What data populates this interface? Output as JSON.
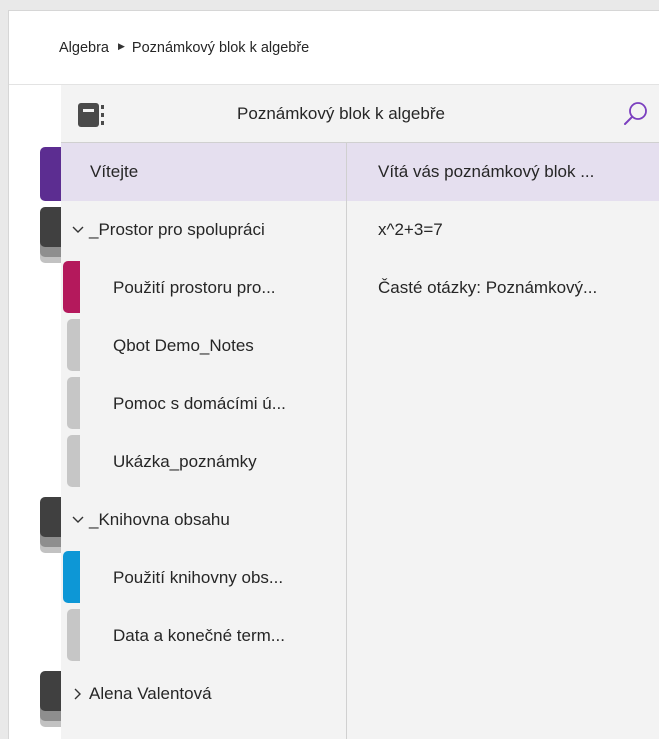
{
  "breadcrumb": {
    "notebook_group": "Algebra",
    "separator": "▶",
    "notebook": "Poznámkový blok k algebře"
  },
  "notebook_header": {
    "title": "Poznámkový blok k algebře",
    "icon": "notebook-icon",
    "search_icon": "search-icon"
  },
  "accent_color": "#5c2d91",
  "selection_color": "#e5dfef",
  "sections": {
    "welcome": "Vítejte",
    "collab_group": {
      "label": "_Prostor pro spolupráci",
      "expanded": true,
      "items": [
        {
          "label": "Použití prostoru pro...",
          "color": "#b4195c"
        },
        {
          "label": "Qbot Demo_Notes",
          "color": "#c6c6c6"
        },
        {
          "label": "Pomoc s domácími ú...",
          "color": "#c6c6c6"
        },
        {
          "label": "Ukázka_poznámky",
          "color": "#c6c6c6"
        }
      ]
    },
    "content_group": {
      "label": "_Knihovna obsahu",
      "expanded": true,
      "items": [
        {
          "label": "Použití knihovny obs...",
          "color": "#0d97d6"
        },
        {
          "label": "Data a konečné term...",
          "color": "#c6c6c6"
        }
      ]
    },
    "student_group": {
      "label": "Alena Valentová",
      "expanded": false
    }
  },
  "pages": [
    "Vítá vás poznámkový blok ...",
    "x^2+3=7",
    "Časté otázky: Poznámkový..."
  ],
  "chevrons": {
    "expanded": "⌄",
    "collapsed": "›"
  }
}
